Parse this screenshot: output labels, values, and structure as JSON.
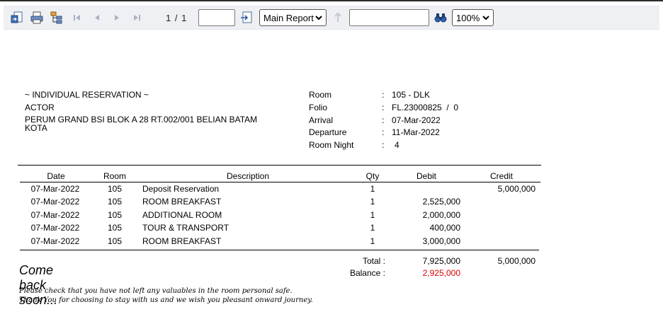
{
  "toolbar": {
    "page_indicator": "1 / 1",
    "page_input": "",
    "report_select": "Main Report",
    "search_input": "",
    "zoom_select": "100%"
  },
  "header": {
    "title": "~ INDIVIDUAL RESERVATION ~",
    "guest_name": "ACTOR",
    "address": "PERUM GRAND BSI BLOK A 28 RT.002/001 BELIAN BATAM KOTA",
    "fields": [
      {
        "label": "Room",
        "value": "105 - DLK"
      },
      {
        "label": "Folio",
        "value": "FL.23000825  /  0"
      },
      {
        "label": "Arrival",
        "value": "07-Mar-2022"
      },
      {
        "label": "Departure",
        "value": "11-Mar-2022"
      },
      {
        "label": "Room Night",
        "value": "4"
      }
    ]
  },
  "table": {
    "columns": {
      "date": "Date",
      "room": "Room",
      "description": "Description",
      "qty": "Qty",
      "debit": "Debit",
      "credit": "Credit"
    },
    "rows": [
      {
        "date": "07-Mar-2022",
        "room": "105",
        "description": "Deposit Reservation",
        "qty": "1",
        "debit": "",
        "credit": "5,000,000"
      },
      {
        "date": "07-Mar-2022",
        "room": "105",
        "description": "ROOM BREAKFAST",
        "qty": "1",
        "debit": "2,525,000",
        "credit": ""
      },
      {
        "date": "07-Mar-2022",
        "room": "105",
        "description": "ADDITIONAL ROOM",
        "qty": "1",
        "debit": "2,000,000",
        "credit": ""
      },
      {
        "date": "07-Mar-2022",
        "room": "105",
        "description": "TOUR & TRANSPORT",
        "qty": "1",
        "debit": "400,000",
        "credit": ""
      },
      {
        "date": "07-Mar-2022",
        "room": "105",
        "description": "ROOM BREAKFAST",
        "qty": "1",
        "debit": "3,000,000",
        "credit": ""
      }
    ]
  },
  "totals": {
    "total_label": "Total :",
    "total_debit": "7,925,000",
    "total_credit": "5,000,000",
    "balance_label": "Balance :",
    "balance_value": "2,925,000",
    "balance_color": "#e00000"
  },
  "footer": {
    "closing": "Come back soon...",
    "note1": "Please check that you have not left any valuables in the room personal safe.",
    "note2": "Thank You for choosing to stay with us and we wish you pleasant onward journey."
  },
  "icons": [
    "export-icon",
    "print-icon",
    "group-tree-icon",
    "first-page-icon",
    "prev-page-icon",
    "next-page-icon",
    "last-page-icon",
    "goto-page-icon",
    "drill-up-icon",
    "search-icon"
  ]
}
